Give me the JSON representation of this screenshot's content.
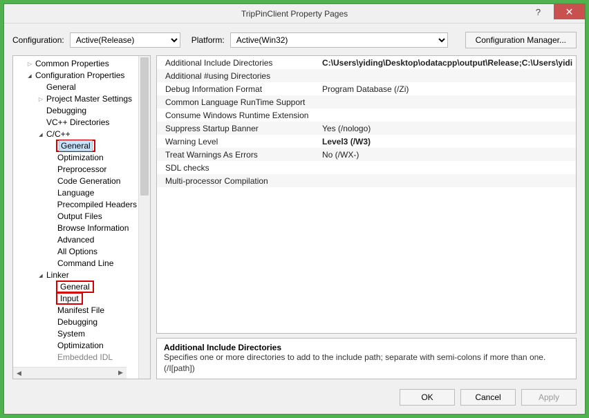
{
  "title": "TripPinClient Property Pages",
  "toolbar": {
    "config_label": "Configuration:",
    "config_value": "Active(Release)",
    "platform_label": "Platform:",
    "platform_value": "Active(Win32)",
    "mgr_label": "Configuration Manager..."
  },
  "tree": {
    "n1": "Common Properties",
    "n2": "Configuration Properties",
    "n3": "General",
    "n4": "Project Master Settings",
    "n5": "Debugging",
    "n6": "VC++ Directories",
    "n7": "C/C++",
    "n8": "General",
    "n9": "Optimization",
    "n10": "Preprocessor",
    "n11": "Code Generation",
    "n12": "Language",
    "n13": "Precompiled Headers",
    "n14": "Output Files",
    "n15": "Browse Information",
    "n16": "Advanced",
    "n17": "All Options",
    "n18": "Command Line",
    "n19": "Linker",
    "n20": "General",
    "n21": "Input",
    "n22": "Manifest File",
    "n23": "Debugging",
    "n24": "System",
    "n25": "Optimization",
    "n26": "Embedded IDL"
  },
  "props": [
    {
      "name": "Additional Include Directories",
      "val": "C:\\Users\\yiding\\Desktop\\odatacpp\\output\\Release;C:\\Users\\yidi",
      "bold": true
    },
    {
      "name": "Additional #using Directories",
      "val": ""
    },
    {
      "name": "Debug Information Format",
      "val": "Program Database (/Zi)"
    },
    {
      "name": "Common Language RunTime Support",
      "val": ""
    },
    {
      "name": "Consume Windows Runtime Extension",
      "val": ""
    },
    {
      "name": "Suppress Startup Banner",
      "val": "Yes (/nologo)"
    },
    {
      "name": "Warning Level",
      "val": "Level3 (/W3)",
      "bold": true
    },
    {
      "name": "Treat Warnings As Errors",
      "val": "No (/WX-)"
    },
    {
      "name": "SDL checks",
      "val": ""
    },
    {
      "name": "Multi-processor Compilation",
      "val": ""
    }
  ],
  "desc": {
    "title": "Additional Include Directories",
    "body": "Specifies one or more directories to add to the include path; separate with semi-colons if more than one. (/I[path])"
  },
  "footer": {
    "ok": "OK",
    "cancel": "Cancel",
    "apply": "Apply"
  }
}
